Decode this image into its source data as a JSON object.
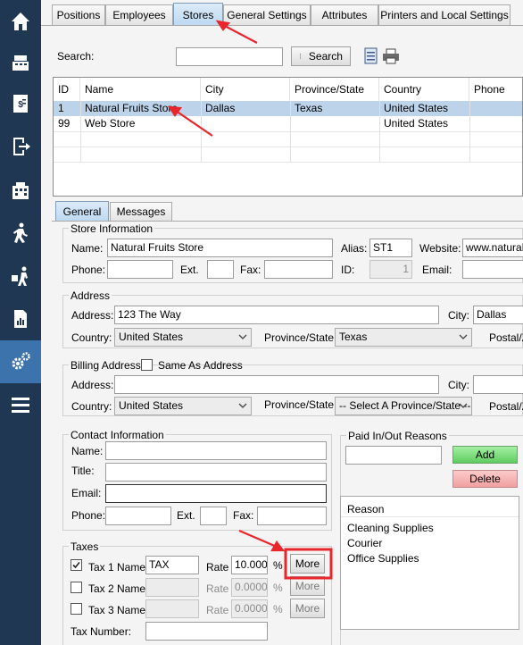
{
  "top_tabs": [
    "Positions",
    "Employees",
    "Stores",
    "General Settings",
    "Attributes",
    "Printers and Local Settings"
  ],
  "search": {
    "label": "Search:",
    "value": "",
    "button": "Search"
  },
  "stores_grid": {
    "columns": [
      "ID",
      "Name",
      "City",
      "Province/State",
      "Country",
      "Phone"
    ],
    "rows": [
      {
        "id": "1",
        "name": "Natural Fruits Store",
        "city": "Dallas",
        "province": "Texas",
        "country": "United States",
        "phone": ""
      },
      {
        "id": "99",
        "name": "Web Store",
        "city": "",
        "province": "",
        "country": "United States",
        "phone": ""
      }
    ]
  },
  "sub_tabs": [
    "General",
    "Messages"
  ],
  "store_info": {
    "title": "Store Information",
    "name_label": "Name:",
    "name_value": "Natural Fruits Store",
    "alias_label": "Alias:",
    "alias_value": "ST1",
    "website_label": "Website:",
    "website_value": "www.naturalfr",
    "phone_label": "Phone:",
    "ext_label": "Ext.",
    "fax_label": "Fax:",
    "id_label": "ID:",
    "id_value": "1",
    "email_label": "Email:"
  },
  "address": {
    "title": "Address",
    "address_label": "Address:",
    "address_value": "123 The Way",
    "city_label": "City:",
    "city_value": "Dallas",
    "country_label": "Country:",
    "country_value": "United States",
    "province_label": "Province/State:",
    "province_value": "Texas",
    "postal_label": "Postal/Z"
  },
  "billing": {
    "title": "Billing Address -",
    "same_label": "Same As Address",
    "address_label": "Address:",
    "city_label": "City:",
    "country_label": "Country:",
    "country_value": "United States",
    "province_label": "Province/State:",
    "province_value": "-- Select A Province/State --",
    "postal_label": "Postal/Z"
  },
  "contact": {
    "title": "Contact Information",
    "name_label": "Name:",
    "title_label": "Title:",
    "email_label": "Email:",
    "phone_label": "Phone:",
    "ext_label": "Ext.",
    "fax_label": "Fax:"
  },
  "taxes": {
    "title": "Taxes",
    "rows": [
      {
        "label": "Tax 1 Name",
        "checked": true,
        "name": "TAX",
        "rate": "10.000",
        "enabled": true
      },
      {
        "label": "Tax 2 Name",
        "checked": false,
        "name": "",
        "rate": "0.0000",
        "enabled": false
      },
      {
        "label": "Tax 3 Name",
        "checked": false,
        "name": "",
        "rate": "0.0000",
        "enabled": false
      }
    ],
    "rate_label": "Rate",
    "pct": "%",
    "more": "More",
    "tax_number_label": "Tax Number:"
  },
  "paid_reasons": {
    "title": "Paid In/Out Reasons",
    "add": "Add",
    "delete": "Delete",
    "list_header": "Reason",
    "items": [
      "Cleaning Supplies",
      "Courier",
      "Office Supplies"
    ]
  },
  "colors": {
    "sidebar": "#1f3752",
    "sidebar_active": "#3d73ad",
    "annotation": "#e8262b",
    "selected_row": "#bcd3ea",
    "add_green": "#6fd66f",
    "delete_red": "#f2a1a1"
  },
  "sidebar_icons": [
    "home-icon",
    "cash-register-icon",
    "receipt-icon",
    "logout-icon",
    "building-icon",
    "walking-person-icon",
    "delivery-person-icon",
    "report-icon",
    "settings-gears-icon",
    "menu-icon"
  ]
}
